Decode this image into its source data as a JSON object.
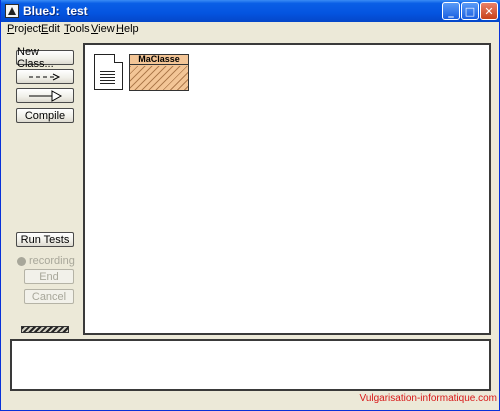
{
  "window": {
    "title": "BlueJ:  test"
  },
  "menubar": {
    "items": [
      {
        "mnemonic": "P",
        "rest": "roject"
      },
      {
        "mnemonic": "E",
        "rest": "dit"
      },
      {
        "mnemonic": "T",
        "rest": "ools"
      },
      {
        "mnemonic": "V",
        "rest": "iew"
      },
      {
        "mnemonic": "H",
        "rest": "elp"
      }
    ]
  },
  "toolbar": {
    "new_class": "New Class...",
    "uses_arrow": "- - ->",
    "inherit_arrow": "—▷",
    "compile": "Compile"
  },
  "test_panel": {
    "run_tests": "Run Tests",
    "recording": "recording",
    "end": "End",
    "cancel": "Cancel"
  },
  "diagram": {
    "classes": [
      {
        "name": "MaClasse",
        "state": "uncompiled"
      }
    ]
  },
  "watermark": "Vulgarisation-informatique.com",
  "colors": {
    "titlebar": "#0454e0",
    "window_bg": "#ece9d8",
    "class_fill": "#f3c596",
    "watermark": "#d81818"
  },
  "icons": [
    "bluej-app-icon",
    "minimize-icon",
    "maximize-icon",
    "close-icon",
    "readme-icon",
    "progress-indicator"
  ]
}
